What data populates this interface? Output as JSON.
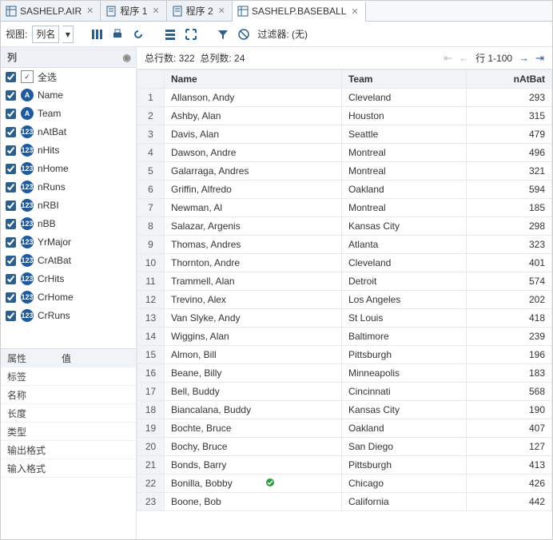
{
  "tabs": [
    {
      "label": "SASHELP.AIR",
      "active": false,
      "icon": "table"
    },
    {
      "label": "程序 1",
      "active": false,
      "icon": "prog"
    },
    {
      "label": "程序 2",
      "active": false,
      "icon": "prog"
    },
    {
      "label": "SASHELP.BASEBALL",
      "active": true,
      "icon": "table"
    }
  ],
  "view_label": "视图:",
  "view_value": "列名",
  "filter_label": "过滤器: (无)",
  "sidebar": {
    "title": "列",
    "select_all": "全选",
    "columns": [
      {
        "name": "Name",
        "type": "char"
      },
      {
        "name": "Team",
        "type": "char"
      },
      {
        "name": "nAtBat",
        "type": "num"
      },
      {
        "name": "nHits",
        "type": "num"
      },
      {
        "name": "nHome",
        "type": "num"
      },
      {
        "name": "nRuns",
        "type": "num"
      },
      {
        "name": "nRBI",
        "type": "num"
      },
      {
        "name": "nBB",
        "type": "num"
      },
      {
        "name": "YrMajor",
        "type": "num"
      },
      {
        "name": "CrAtBat",
        "type": "num"
      },
      {
        "name": "CrHits",
        "type": "num"
      },
      {
        "name": "CrHome",
        "type": "num"
      },
      {
        "name": "CrRuns",
        "type": "num"
      }
    ],
    "props_header_attr": "属性",
    "props_header_val": "值",
    "props": [
      {
        "k": "标签",
        "v": ""
      },
      {
        "k": "名称",
        "v": ""
      },
      {
        "k": "长度",
        "v": ""
      },
      {
        "k": "类型",
        "v": ""
      },
      {
        "k": "输出格式",
        "v": ""
      },
      {
        "k": "输入格式",
        "v": ""
      }
    ]
  },
  "grid": {
    "total_rows_label": "总行数: 322",
    "total_cols_label": "总列数: 24",
    "page_label": "行 1-100",
    "headers": [
      "Name",
      "Team",
      "nAtBat"
    ],
    "rows": [
      {
        "n": 1,
        "Name": "Allanson, Andy",
        "Team": "Cleveland",
        "nAtBat": 293
      },
      {
        "n": 2,
        "Name": "Ashby, Alan",
        "Team": "Houston",
        "nAtBat": 315
      },
      {
        "n": 3,
        "Name": "Davis, Alan",
        "Team": "Seattle",
        "nAtBat": 479
      },
      {
        "n": 4,
        "Name": "Dawson, Andre",
        "Team": "Montreal",
        "nAtBat": 496
      },
      {
        "n": 5,
        "Name": "Galarraga, Andres",
        "Team": "Montreal",
        "nAtBat": 321
      },
      {
        "n": 6,
        "Name": "Griffin, Alfredo",
        "Team": "Oakland",
        "nAtBat": 594
      },
      {
        "n": 7,
        "Name": "Newman, Al",
        "Team": "Montreal",
        "nAtBat": 185
      },
      {
        "n": 8,
        "Name": "Salazar, Argenis",
        "Team": "Kansas City",
        "nAtBat": 298
      },
      {
        "n": 9,
        "Name": "Thomas, Andres",
        "Team": "Atlanta",
        "nAtBat": 323
      },
      {
        "n": 10,
        "Name": "Thornton, Andre",
        "Team": "Cleveland",
        "nAtBat": 401
      },
      {
        "n": 11,
        "Name": "Trammell, Alan",
        "Team": "Detroit",
        "nAtBat": 574
      },
      {
        "n": 12,
        "Name": "Trevino, Alex",
        "Team": "Los Angeles",
        "nAtBat": 202
      },
      {
        "n": 13,
        "Name": "Van Slyke, Andy",
        "Team": "St Louis",
        "nAtBat": 418
      },
      {
        "n": 14,
        "Name": "Wiggins, Alan",
        "Team": "Baltimore",
        "nAtBat": 239
      },
      {
        "n": 15,
        "Name": "Almon, Bill",
        "Team": "Pittsburgh",
        "nAtBat": 196
      },
      {
        "n": 16,
        "Name": "Beane, Billy",
        "Team": "Minneapolis",
        "nAtBat": 183
      },
      {
        "n": 17,
        "Name": "Bell, Buddy",
        "Team": "Cincinnati",
        "nAtBat": 568
      },
      {
        "n": 18,
        "Name": "Biancalana, Buddy",
        "Team": "Kansas City",
        "nAtBat": 190
      },
      {
        "n": 19,
        "Name": "Bochte, Bruce",
        "Team": "Oakland",
        "nAtBat": 407
      },
      {
        "n": 20,
        "Name": "Bochy, Bruce",
        "Team": "San Diego",
        "nAtBat": 127
      },
      {
        "n": 21,
        "Name": "Bonds, Barry",
        "Team": "Pittsburgh",
        "nAtBat": 413
      },
      {
        "n": 22,
        "Name": "Bonilla, Bobby",
        "Team": "Chicago",
        "nAtBat": 426
      },
      {
        "n": 23,
        "Name": "Boone, Bob",
        "Team": "California",
        "nAtBat": 442
      }
    ]
  }
}
